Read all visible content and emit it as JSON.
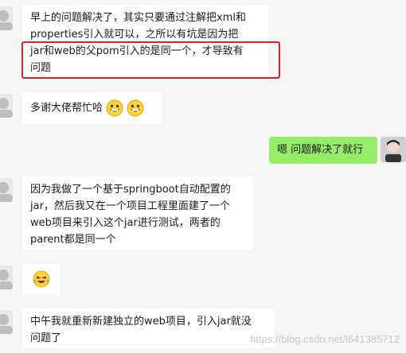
{
  "messages": [
    {
      "from": "other",
      "lines": [
        "早上的问题解决了，其实只要通过注解把xml和",
        "properties引入就可以，之所以有坑是因为把",
        "jar和web的父pom引入的是同一个，才导致有",
        "问题"
      ]
    },
    {
      "from": "other",
      "text": "多谢大佬帮忙哈",
      "emojis": [
        "grin-emoji",
        "grin-emoji"
      ]
    },
    {
      "from": "me",
      "text": "嗯 问题解决了就行"
    },
    {
      "from": "other",
      "lines": [
        "因为我做了一个基于springboot自动配置的",
        "jar，然后我又在一个项目工程里面建了一个",
        "web项目来引入这个jar进行测试，两者的",
        "parent都是同一个"
      ]
    },
    {
      "from": "other",
      "emojis": [
        "laugh-cry-emoji"
      ]
    },
    {
      "from": "other",
      "lines": [
        "中午我就重新新建独立的web项目，引入jar就没",
        "问题了"
      ]
    }
  ],
  "watermark": "https://blog.csdn.net/l641385712",
  "colors": {
    "bubble_me": "#95ec69",
    "bubble_other": "#ffffff",
    "highlight": "#e02020",
    "background": "#f5f5f5"
  }
}
